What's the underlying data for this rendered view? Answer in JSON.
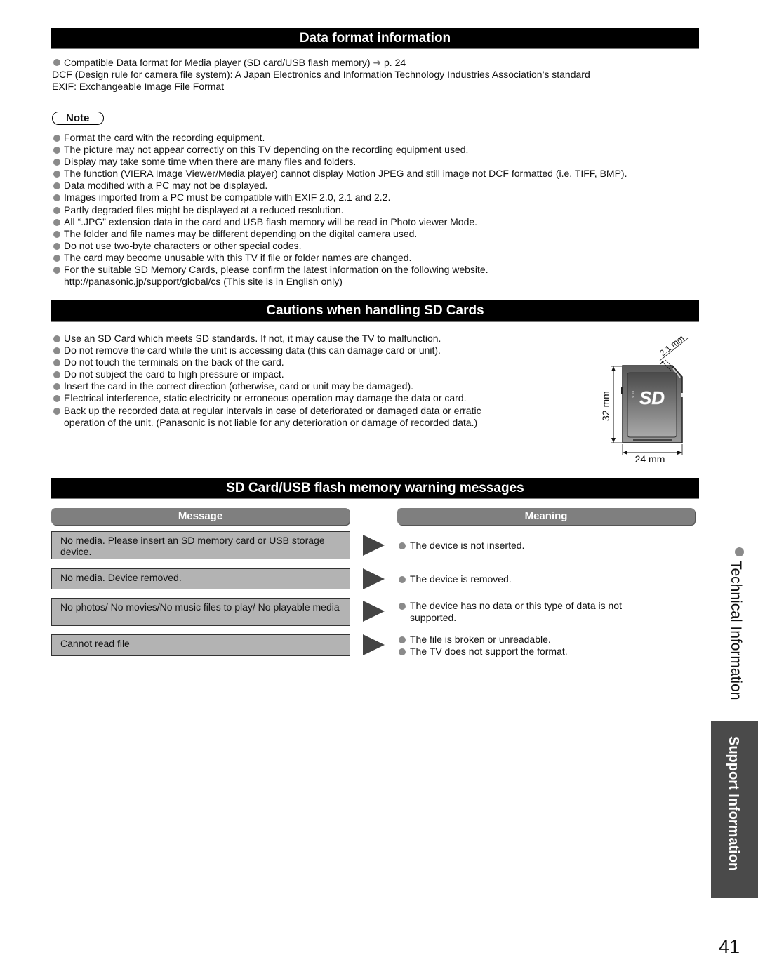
{
  "sections": {
    "data_format": {
      "title": "Data format information",
      "intro": {
        "bullet_text": "Compatible Data format for Media player (SD card/USB flash memory)",
        "page_ref": "p. 24",
        "lines": [
          "DCF (Design rule for camera file system): A Japan Electronics and Information Technology Industries Association’s standard",
          "EXIF: Exchangeable Image File Format"
        ]
      },
      "note_label": "Note",
      "notes": [
        "Format the card with the recording equipment.",
        "The picture may not appear correctly on this TV depending on the recording equipment used.",
        "Display may take some time when there are many files and folders.",
        "The function (VIERA Image Viewer/Media player) cannot display Motion JPEG and still image not DCF formatted (i.e. TIFF, BMP).",
        "Data modified with a PC may not be displayed.",
        "Images imported from a PC must be compatible with EXIF 2.0, 2.1 and 2.2.",
        "Partly degraded files might be displayed at a reduced resolution.",
        "All “.JPG” extension data in the card and USB flash memory will be read in Photo viewer Mode.",
        "The folder and file names may be different depending on the digital camera used.",
        "Do not use two-byte characters or other special codes.",
        "The card may become unusable with this TV if file or folder names are changed.",
        "For the suitable SD Memory Cards, please confirm the latest information on the following website."
      ],
      "website_line": "http://panasonic.jp/support/global/cs (This site is in English only)"
    },
    "cautions": {
      "title": "Cautions when handling SD Cards",
      "items": [
        "Use an SD Card which meets SD standards. If not, it may cause the TV to malfunction.",
        "Do not remove the card while the unit is accessing data (this can damage card or unit).",
        "Do not touch the terminals on the back of the card.",
        "Do not subject the card to high pressure or impact.",
        "Insert the card in the correct direction (otherwise, card or unit may be damaged).",
        "Electrical interference, static electricity or erroneous operation may damage the data or card.",
        "Back up the recorded data at regular intervals in case of deteriorated or damaged data or erratic"
      ],
      "items_continuation": "operation of the unit. (Panasonic is not liable for any deterioration or damage of recorded data.)",
      "card_diagram": {
        "height_label": "32 mm",
        "width_label": "24 mm",
        "thickness_label": "2.1 mm",
        "logo_text": "SD",
        "lock_text": "LOCK"
      }
    },
    "warnings": {
      "title": "SD Card/USB flash memory warning messages",
      "col_message": "Message",
      "col_meaning": "Meaning",
      "rows": [
        {
          "message": "No media. Please insert an SD memory card or USB storage device.",
          "meanings": [
            "The device is not inserted."
          ]
        },
        {
          "message": "No media. Device removed.",
          "meanings": [
            "The device is removed."
          ]
        },
        {
          "message": "No photos/ No movies/No music files to play/ No playable media",
          "meanings": [
            "The device has no data or this type of data is not supported."
          ]
        },
        {
          "message": "Cannot read file",
          "meanings": [
            "The file is broken or unreadable.",
            "The TV does not support the format."
          ]
        }
      ]
    }
  },
  "side_tabs": {
    "technical": "Technical Information",
    "support": "Support Information"
  },
  "page_number": "41",
  "colors": {
    "section_bar": "#000000",
    "column_header": "#7f7f7f",
    "message_box": "#b3b3b3",
    "side_tab": "#4a4a4a",
    "bullet": "#8a8a8a"
  }
}
